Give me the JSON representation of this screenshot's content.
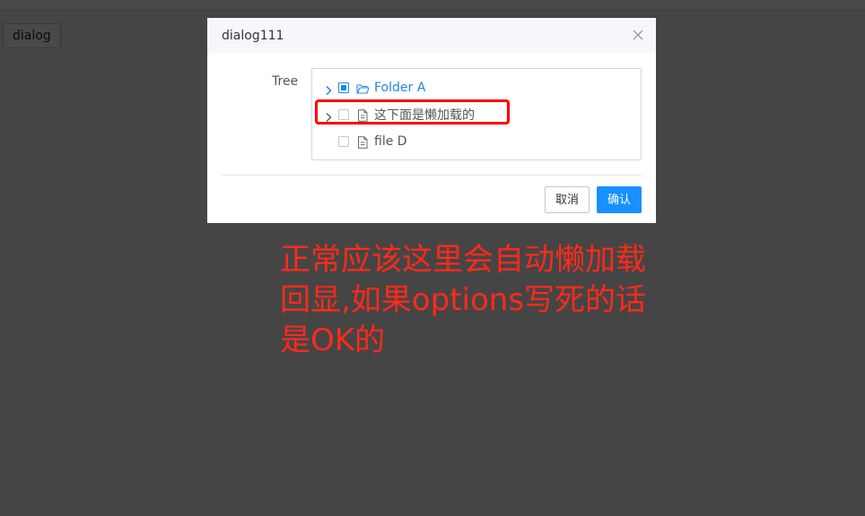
{
  "page": {
    "dialog_button_label": "dialog"
  },
  "dialog": {
    "title": "dialog111",
    "form_label": "Tree",
    "tree": {
      "nodes": [
        {
          "label": "Folder A",
          "expandable": true,
          "state": "indeterminate",
          "icon": "folder-open-icon",
          "active": true
        },
        {
          "label": "这下面是懒加载的",
          "expandable": true,
          "state": "unchecked",
          "icon": "document-icon",
          "active": false
        },
        {
          "label": "file D",
          "expandable": false,
          "state": "unchecked",
          "icon": "document-icon",
          "active": false
        }
      ]
    },
    "buttons": {
      "cancel_label": "取消",
      "confirm_label": "确认"
    }
  },
  "annotation": {
    "text": "正常应该这里会自动懒加载回显,如果options写死的话是OK的"
  },
  "colors": {
    "accent": "#1890ff",
    "annotation": "#ff2a1a",
    "highlight": "#ff0000"
  }
}
